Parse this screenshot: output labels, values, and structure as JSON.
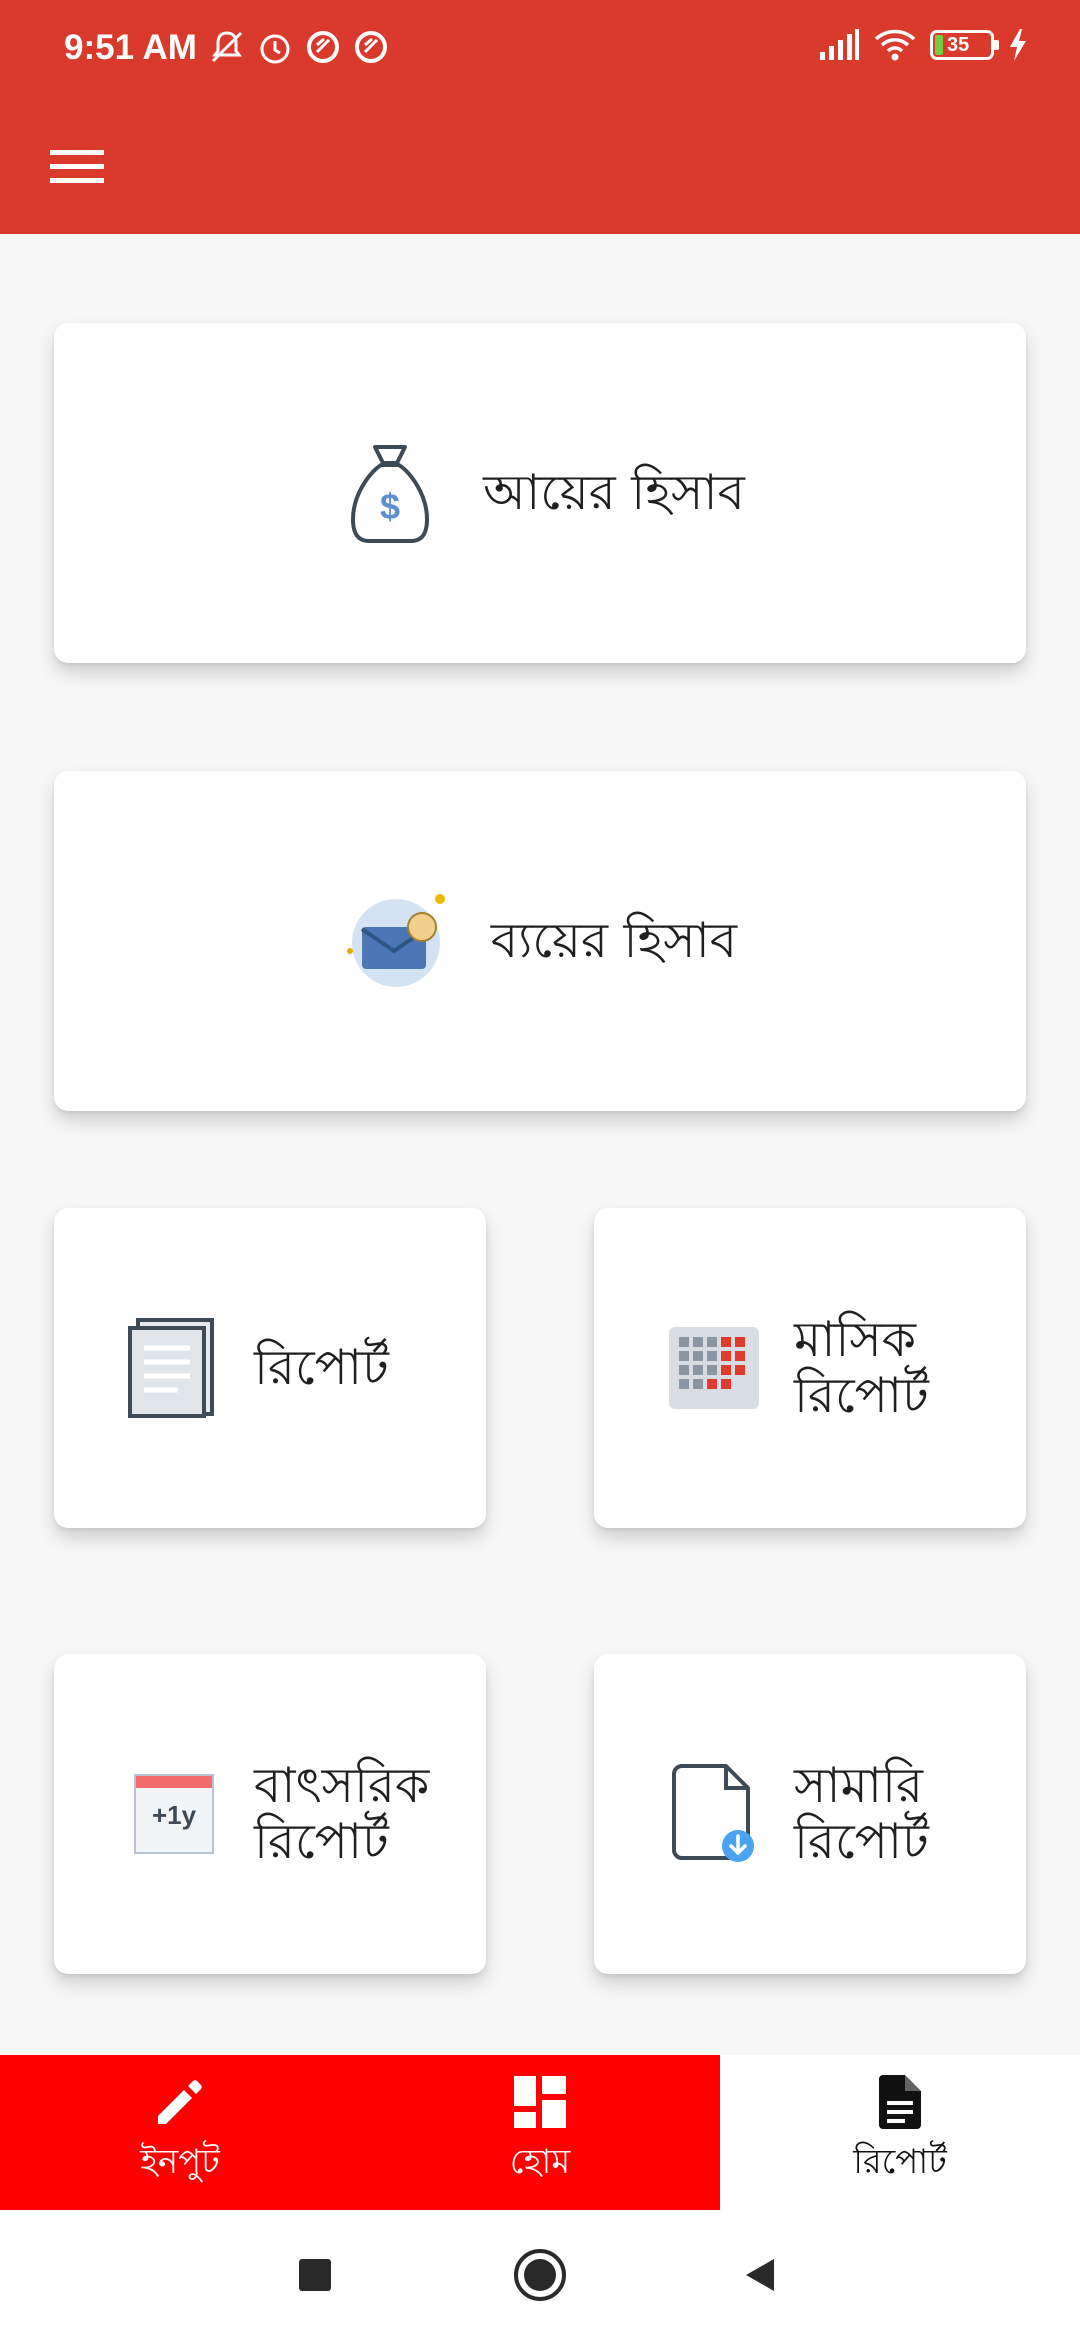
{
  "status_bar": {
    "time": "9:51 AM",
    "battery_level": "35",
    "left_icons": [
      "mute-icon",
      "alarm-icon",
      "app-icon",
      "app-icon"
    ],
    "right_icons": [
      "signal-icon",
      "wifi-icon",
      "battery-icon",
      "charging-icon"
    ]
  },
  "app_bar": {
    "menu_icon": "hamburger-menu-icon",
    "background_color": "#d93a2c"
  },
  "cards": {
    "income": {
      "label": "আয়ের হিসাব",
      "icon": "money-bag-icon"
    },
    "expense": {
      "label": "ব্যয়ের হিসাব",
      "icon": "envelope-icon"
    },
    "report": {
      "label": "রিপোর্ট",
      "icon": "document-icon"
    },
    "monthly_report": {
      "label": "মাসিক রিপোর্ট",
      "icon": "calendar-grid-icon"
    },
    "yearly_report": {
      "label": "বাৎসরিক রিপোর্ট",
      "icon": "calendar-year-icon",
      "badge": "+1y"
    },
    "summary_report": {
      "label": "সামারি রিপোর্ট",
      "icon": "file-download-icon"
    }
  },
  "bottom_nav": {
    "items": [
      {
        "label": "ইনপুট",
        "icon": "pencil-icon",
        "selected": false
      },
      {
        "label": "হোম",
        "icon": "dashboard-icon",
        "selected": false
      },
      {
        "label": "রিপোর্ট",
        "icon": "report-file-icon",
        "selected": true
      }
    ],
    "accent_color": "#ff0000"
  },
  "system_nav": {
    "icons": [
      "recents-square-icon",
      "home-circle-icon",
      "back-triangle-icon"
    ]
  }
}
